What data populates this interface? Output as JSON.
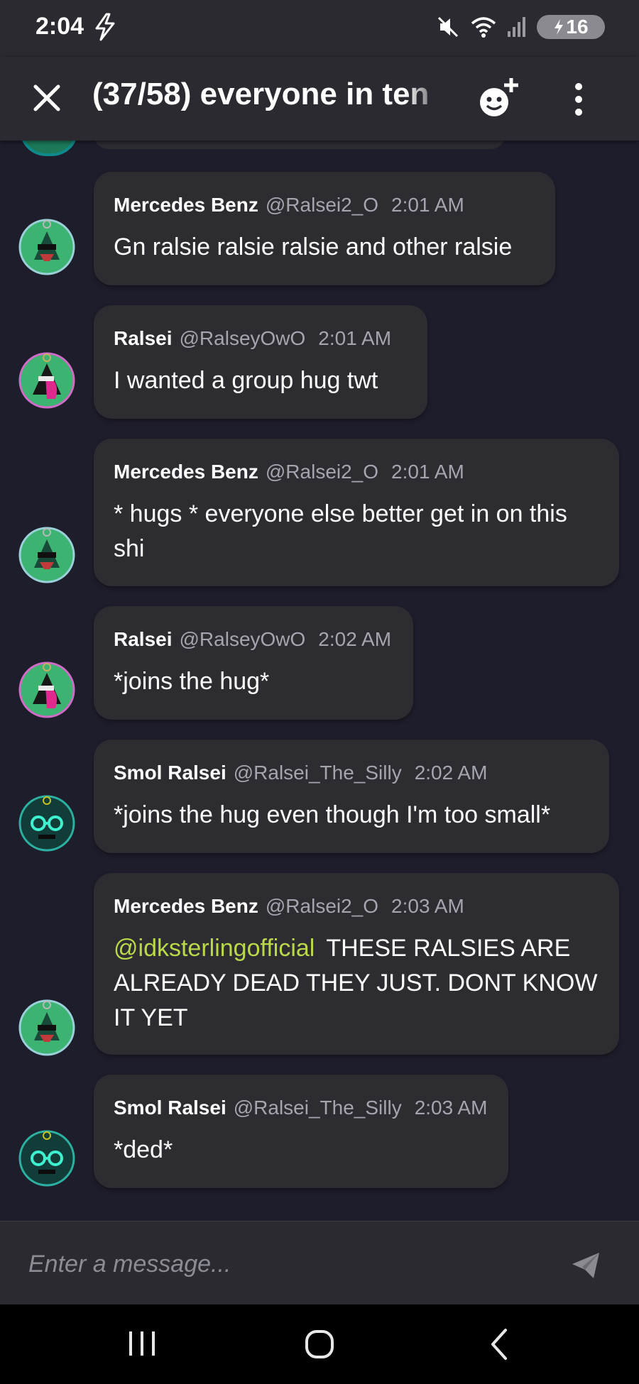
{
  "status_bar": {
    "time": "2:04",
    "battery_level": "16"
  },
  "header": {
    "title": "(37/58) everyone in ten"
  },
  "messages": [
    {
      "author": "Mercedes Benz",
      "handle": "@Ralsei2_O",
      "time": "2:01 AM",
      "text": "Gn ralsie ralsie ralsie and other ralsie",
      "avatar": "green-ralsei-avatar"
    },
    {
      "author": "Ralsei",
      "handle": "@RalseyOwO",
      "time": "2:01 AM",
      "text": "I wanted a group hug twt",
      "avatar": "pink-ralsei-avatar"
    },
    {
      "author": "Mercedes Benz",
      "handle": "@Ralsei2_O",
      "time": "2:01 AM",
      "text": "* hugs * everyone else better get in on this shi",
      "avatar": "green-ralsei-avatar"
    },
    {
      "author": "Ralsei",
      "handle": "@RalseyOwO",
      "time": "2:02 AM",
      "text": "*joins the hug*",
      "avatar": "pink-ralsei-avatar"
    },
    {
      "author": "Smol Ralsei",
      "handle": "@Ralsei_The_Silly",
      "time": "2:02 AM",
      "text": "*joins the hug even though I'm too small*",
      "avatar": "pixel-ralsei-avatar"
    },
    {
      "author": "Mercedes Benz",
      "handle": "@Ralsei2_O",
      "time": "2:03 AM",
      "mention": "@idksterlingofficial",
      "text": "THESE RALSIES ARE ALREADY DEAD THEY JUST. DONT KNOW IT YET",
      "avatar": "green-ralsei-avatar"
    },
    {
      "author": "Smol Ralsei",
      "handle": "@Ralsei_The_Silly",
      "time": "2:03 AM",
      "text": "*ded*",
      "avatar": "pixel-ralsei-avatar"
    }
  ],
  "composer": {
    "placeholder": "Enter a message..."
  },
  "icons": {
    "close": "close-icon",
    "add_emoji": "add-emoji-icon",
    "menu": "more-vert-icon",
    "send": "send-icon",
    "nav_recents": "recents-icon",
    "nav_home": "home-icon",
    "nav_back": "back-icon"
  },
  "colors": {
    "background": "#1e1d2b",
    "bubble": "#2c2c31",
    "bar": "#2a2a30",
    "mention": "#b9d94a"
  }
}
